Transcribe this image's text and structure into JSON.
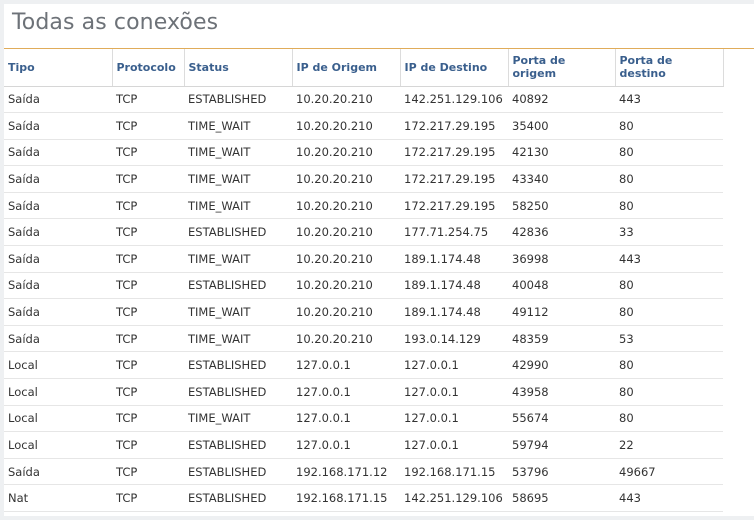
{
  "page": {
    "title": "Todas as conexões"
  },
  "colors": {
    "title": "#6d7278",
    "title_underline": "#e0ac5a",
    "header_text": "#3a5f8d",
    "cell_text": "#333333",
    "background": "#eef0f2"
  },
  "table": {
    "headers": [
      {
        "line1": "Tipo",
        "line2": ""
      },
      {
        "line1": "Protocolo",
        "line2": ""
      },
      {
        "line1": "Status",
        "line2": ""
      },
      {
        "line1": "IP de Origem",
        "line2": ""
      },
      {
        "line1": "IP de Destino",
        "line2": ""
      },
      {
        "line1": "Porta de",
        "line2": "origem"
      },
      {
        "line1": "Porta de",
        "line2": "destino"
      }
    ],
    "rows": [
      [
        "Saída",
        "TCP",
        "ESTABLISHED",
        "10.20.20.210",
        "142.251.129.106",
        "40892",
        "443"
      ],
      [
        "Saída",
        "TCP",
        "TIME_WAIT",
        "10.20.20.210",
        "172.217.29.195",
        "35400",
        "80"
      ],
      [
        "Saída",
        "TCP",
        "TIME_WAIT",
        "10.20.20.210",
        "172.217.29.195",
        "42130",
        "80"
      ],
      [
        "Saída",
        "TCP",
        "TIME_WAIT",
        "10.20.20.210",
        "172.217.29.195",
        "43340",
        "80"
      ],
      [
        "Saída",
        "TCP",
        "TIME_WAIT",
        "10.20.20.210",
        "172.217.29.195",
        "58250",
        "80"
      ],
      [
        "Saída",
        "TCP",
        "ESTABLISHED",
        "10.20.20.210",
        "177.71.254.75",
        "42836",
        "33"
      ],
      [
        "Saída",
        "TCP",
        "TIME_WAIT",
        "10.20.20.210",
        "189.1.174.48",
        "36998",
        "443"
      ],
      [
        "Saída",
        "TCP",
        "ESTABLISHED",
        "10.20.20.210",
        "189.1.174.48",
        "40048",
        "80"
      ],
      [
        "Saída",
        "TCP",
        "TIME_WAIT",
        "10.20.20.210",
        "189.1.174.48",
        "49112",
        "80"
      ],
      [
        "Saída",
        "TCP",
        "TIME_WAIT",
        "10.20.20.210",
        "193.0.14.129",
        "48359",
        "53"
      ],
      [
        "Local",
        "TCP",
        "ESTABLISHED",
        "127.0.0.1",
        "127.0.0.1",
        "42990",
        "80"
      ],
      [
        "Local",
        "TCP",
        "ESTABLISHED",
        "127.0.0.1",
        "127.0.0.1",
        "43958",
        "80"
      ],
      [
        "Local",
        "TCP",
        "TIME_WAIT",
        "127.0.0.1",
        "127.0.0.1",
        "55674",
        "80"
      ],
      [
        "Local",
        "TCP",
        "ESTABLISHED",
        "127.0.0.1",
        "127.0.0.1",
        "59794",
        "22"
      ],
      [
        "Saída",
        "TCP",
        "ESTABLISHED",
        "192.168.171.12",
        "192.168.171.15",
        "53796",
        "49667"
      ],
      [
        "Nat",
        "TCP",
        "ESTABLISHED",
        "192.168.171.15",
        "142.251.129.106",
        "58695",
        "443"
      ]
    ]
  }
}
